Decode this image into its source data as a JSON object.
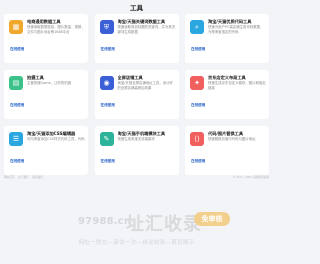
{
  "page": {
    "title": "工具"
  },
  "cards": [
    {
      "icon": "grid-icon",
      "color": "#f0a92d",
      "glyph": "▦",
      "name": "电商通用数据工具",
      "desc": "快速读取数据信息，图片数量，视频，文件与图片地址等1688平台",
      "link": "在线使用"
    },
    {
      "icon": "shield-icon",
      "color": "#3b5fd6",
      "glyph": "⛨",
      "name": "淘宝/天猫关键词数据工具",
      "desc": "快速读取商品标题的关键词，并为其关键词生成数据",
      "link": "在线使用"
    },
    {
      "icon": "search-icon",
      "color": "#2ba7e0",
      "glyph": "⌕",
      "name": "淘宝/天猫优质代码工具",
      "desc": "快速为用户PC端店铺生成代码数据，为帮淘宝指定的代码",
      "link": "在线使用"
    },
    {
      "icon": "chart-icon",
      "color": "#3ac28a",
      "glyph": "▤",
      "name": "拍摄工具",
      "desc": "主营快速Game，让你的拍摄",
      "link": "在线使用"
    },
    {
      "icon": "person-icon",
      "color": "#3b5fd6",
      "glyph": "◉",
      "name": "全屏店铺工具",
      "desc": "淘宝/天猫全屏店铺地址工具，设计好的全屏店铺装修后效果",
      "link": "在线使用"
    },
    {
      "icon": "gift-icon",
      "color": "#f0605e",
      "glyph": "✦",
      "name": "京东店定义布局工具",
      "desc": "快速生成京东自定义模块，图片和指定链接",
      "link": "在线使用"
    },
    {
      "icon": "list-icon",
      "color": "#2ba7e0",
      "glyph": "☰",
      "name": "淘宝/天猫添加CSS编辑器",
      "desc": "可向淘宝添加CSS样式代码工具，代码",
      "link": "在线使用"
    },
    {
      "icon": "bag-icon",
      "color": "#2cb39a",
      "glyph": "✎",
      "name": "淘宝/天猫手机端模块工具",
      "desc": "快速生成淘宝无线端模块",
      "link": "在线使用"
    },
    {
      "icon": "code-icon",
      "color": "#f0605e",
      "glyph": "⟨⟩",
      "name": "代码/图片替换工具",
      "desc": "快速替换页面中代码与图片地址",
      "link": "在线使用"
    }
  ],
  "footer": {
    "links": [
      "网站首页",
      "关于我们",
      "联系我们"
    ],
    "copyright": "© 2017 - 2024 ·保留所有权利"
  },
  "watermark": {
    "domain": "97988.cn",
    "logo": "址汇收录",
    "badge": "免审核",
    "slogan": "网址一提交—请访一次—自动收录—首页展示"
  }
}
